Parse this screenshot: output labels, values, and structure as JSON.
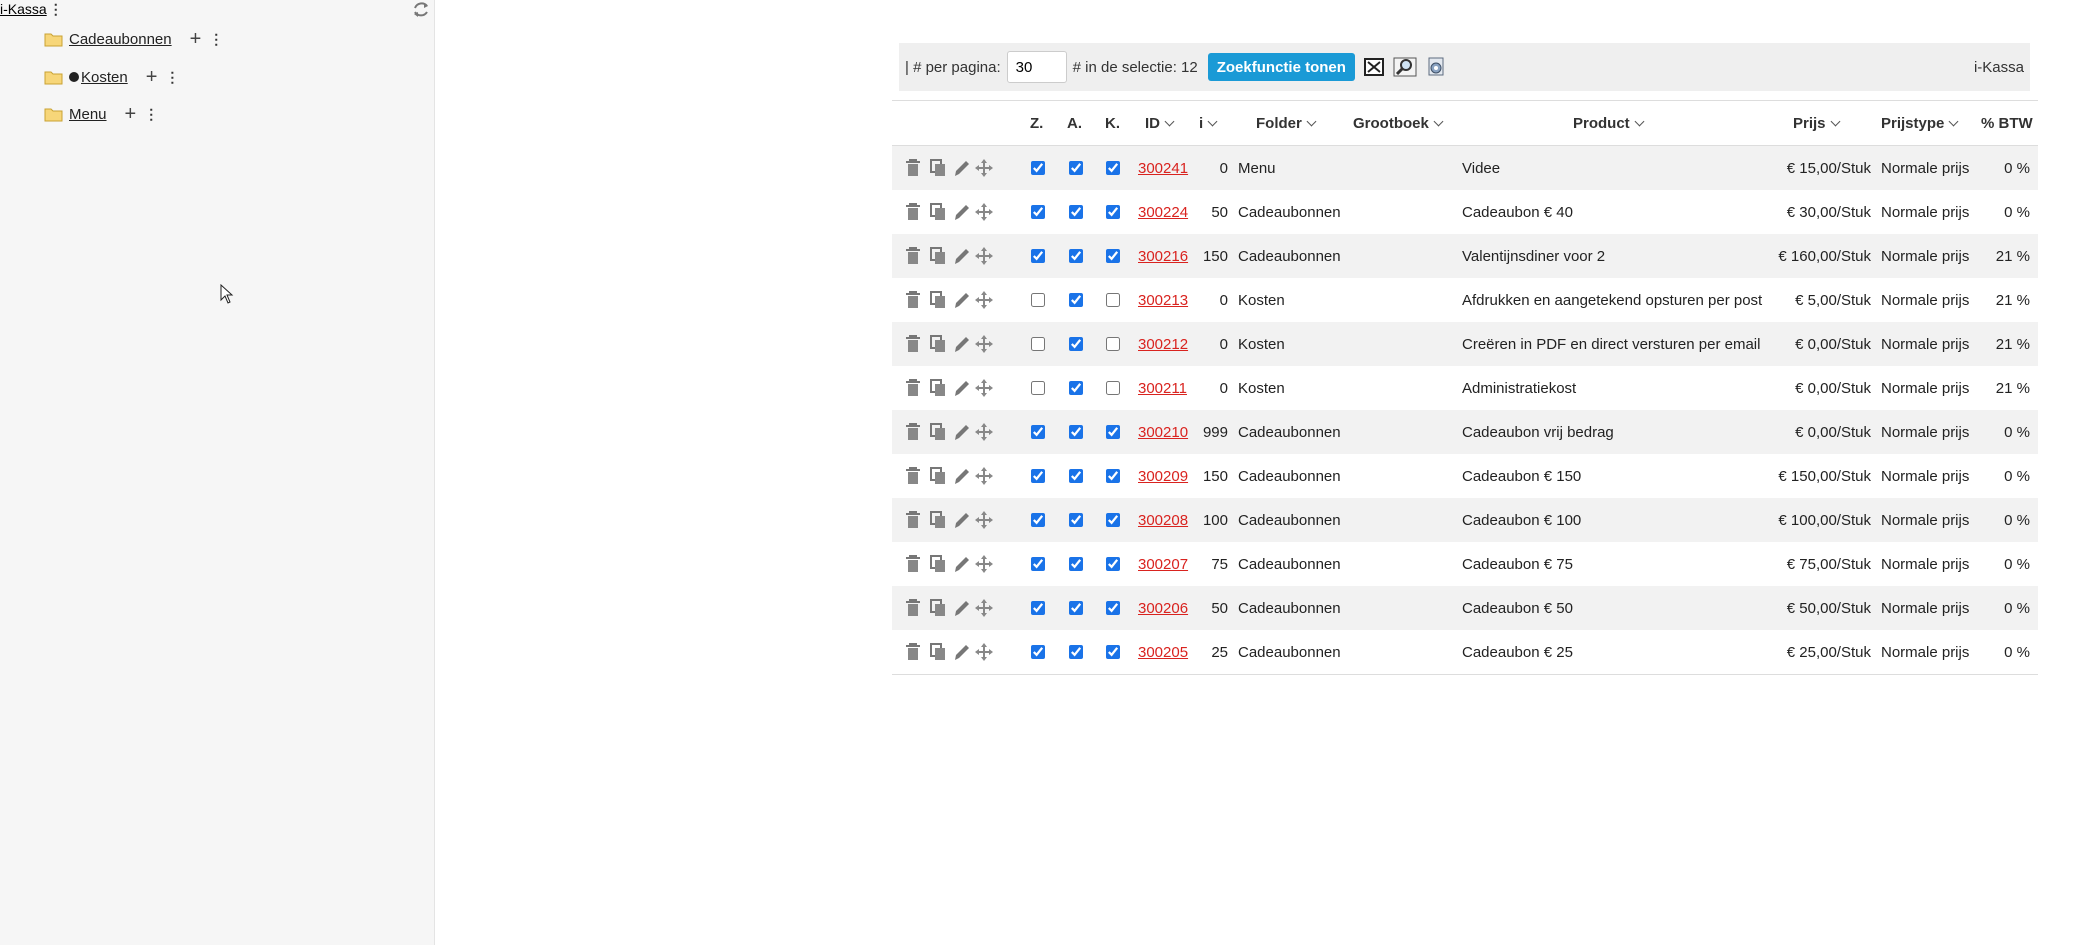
{
  "tree": {
    "root_label": "i-Kassa",
    "menu_dots": "⋮",
    "items": [
      {
        "label": "Cadeaubonnen",
        "bullet": false
      },
      {
        "label": "Kosten",
        "bullet": true
      },
      {
        "label": "Menu",
        "bullet": false
      }
    ],
    "plus": "+"
  },
  "toolbar": {
    "per_page_label": "| # per pagina:",
    "per_page_value": "30",
    "selection_label": "# in de selectie: 12",
    "search_button": "Zoekfunctie tonen",
    "brand": "i-Kassa"
  },
  "columns": {
    "z": "Z.",
    "a": "A.",
    "k": "K.",
    "id": "ID",
    "i": "i",
    "folder": "Folder",
    "grootboek": "Grootboek",
    "product": "Product",
    "prijs": "Prijs",
    "prijstype": "Prijstype",
    "btw": "% BTW"
  },
  "rows": [
    {
      "z": true,
      "a": true,
      "k": true,
      "id": "300241",
      "i": "0",
      "folder": "Menu",
      "grootboek": "",
      "product": "Videe",
      "prijs": "€ 15,00/Stuk",
      "prijstype": "Normale prijs",
      "btw": "0 %"
    },
    {
      "z": true,
      "a": true,
      "k": true,
      "id": "300224",
      "i": "50",
      "folder": "Cadeaubonnen",
      "grootboek": "",
      "product": "Cadeaubon € 40",
      "prijs": "€ 30,00/Stuk",
      "prijstype": "Normale prijs",
      "btw": "0 %"
    },
    {
      "z": true,
      "a": true,
      "k": true,
      "id": "300216",
      "i": "150",
      "folder": "Cadeaubonnen",
      "grootboek": "",
      "product": "Valentijnsdiner voor 2",
      "prijs": "€ 160,00/Stuk",
      "prijstype": "Normale prijs",
      "btw": "21 %"
    },
    {
      "z": false,
      "a": true,
      "k": false,
      "id": "300213",
      "i": "0",
      "folder": "Kosten",
      "grootboek": "",
      "product": "Afdrukken en aangetekend opsturen per post",
      "prijs": "€ 5,00/Stuk",
      "prijstype": "Normale prijs",
      "btw": "21 %"
    },
    {
      "z": false,
      "a": true,
      "k": false,
      "id": "300212",
      "i": "0",
      "folder": "Kosten",
      "grootboek": "",
      "product": "Creëren in PDF en direct versturen per email",
      "prijs": "€ 0,00/Stuk",
      "prijstype": "Normale prijs",
      "btw": "21 %"
    },
    {
      "z": false,
      "a": true,
      "k": false,
      "id": "300211",
      "i": "0",
      "folder": "Kosten",
      "grootboek": "",
      "product": "Administratiekost",
      "prijs": "€ 0,00/Stuk",
      "prijstype": "Normale prijs",
      "btw": "21 %"
    },
    {
      "z": true,
      "a": true,
      "k": true,
      "id": "300210",
      "i": "999",
      "folder": "Cadeaubonnen",
      "grootboek": "",
      "product": "Cadeaubon vrij bedrag",
      "prijs": "€ 0,00/Stuk",
      "prijstype": "Normale prijs",
      "btw": "0 %"
    },
    {
      "z": true,
      "a": true,
      "k": true,
      "id": "300209",
      "i": "150",
      "folder": "Cadeaubonnen",
      "grootboek": "",
      "product": "Cadeaubon € 150",
      "prijs": "€ 150,00/Stuk",
      "prijstype": "Normale prijs",
      "btw": "0 %"
    },
    {
      "z": true,
      "a": true,
      "k": true,
      "id": "300208",
      "i": "100",
      "folder": "Cadeaubonnen",
      "grootboek": "",
      "product": "Cadeaubon € 100",
      "prijs": "€ 100,00/Stuk",
      "prijstype": "Normale prijs",
      "btw": "0 %"
    },
    {
      "z": true,
      "a": true,
      "k": true,
      "id": "300207",
      "i": "75",
      "folder": "Cadeaubonnen",
      "grootboek": "",
      "product": "Cadeaubon € 75",
      "prijs": "€ 75,00/Stuk",
      "prijstype": "Normale prijs",
      "btw": "0 %"
    },
    {
      "z": true,
      "a": true,
      "k": true,
      "id": "300206",
      "i": "50",
      "folder": "Cadeaubonnen",
      "grootboek": "",
      "product": "Cadeaubon € 50",
      "prijs": "€ 50,00/Stuk",
      "prijstype": "Normale prijs",
      "btw": "0 %"
    },
    {
      "z": true,
      "a": true,
      "k": true,
      "id": "300205",
      "i": "25",
      "folder": "Cadeaubonnen",
      "grootboek": "",
      "product": "Cadeaubon € 25",
      "prijs": "€ 25,00/Stuk",
      "prijstype": "Normale prijs",
      "btw": "0 %"
    }
  ]
}
